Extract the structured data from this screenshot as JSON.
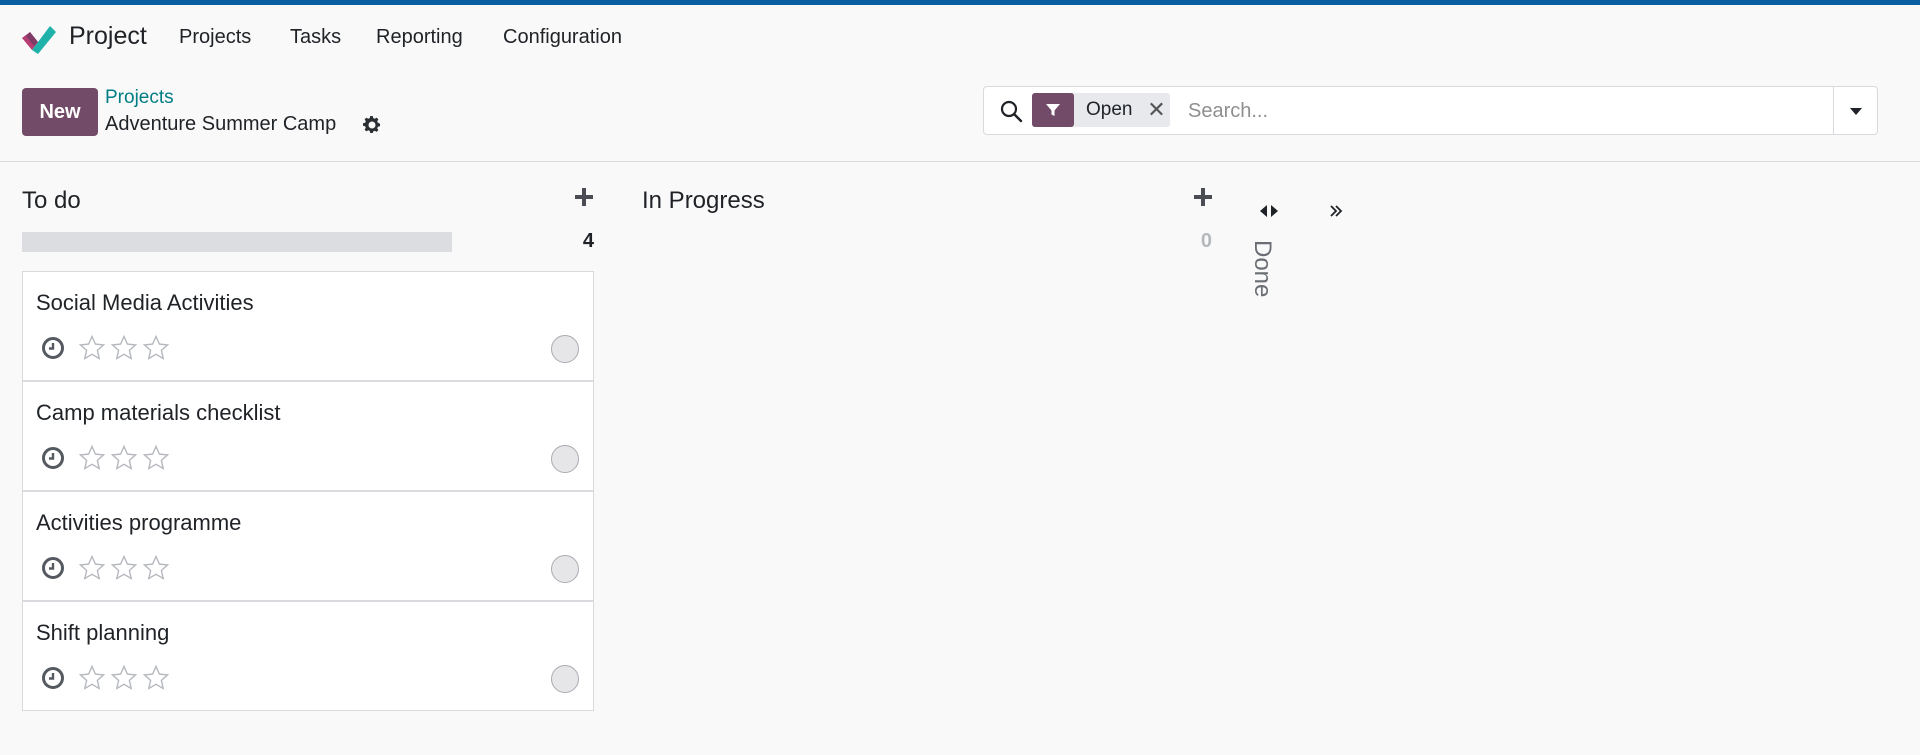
{
  "navbar": {
    "app_name": "Project",
    "menu": [
      "Projects",
      "Tasks",
      "Reporting",
      "Configuration"
    ]
  },
  "control_panel": {
    "new_label": "New",
    "breadcrumb_parent": "Projects",
    "breadcrumb_current": "Adventure Summer Camp",
    "search": {
      "facet_label": "Open",
      "placeholder": "Search..."
    }
  },
  "columns": [
    {
      "title": "To do",
      "count": "4",
      "cards": [
        {
          "title": "Social Media Activities"
        },
        {
          "title": "Camp materials checklist"
        },
        {
          "title": "Activities programme"
        },
        {
          "title": "Shift planning"
        }
      ]
    },
    {
      "title": "In Progress",
      "count": "0",
      "cards": []
    },
    {
      "title": "Done",
      "folded": true
    }
  ],
  "colors": {
    "brand": "#714b67",
    "topbar": "#0b5fa0",
    "link": "#017e84"
  },
  "icons": [
    "project-logo-icon",
    "gear-icon",
    "search-icon",
    "filter-icon",
    "close-icon",
    "caret-down-icon",
    "plus-icon",
    "clock-icon",
    "star-icon",
    "status-circle-icon",
    "fold-arrows-icon",
    "double-chevron-right-icon"
  ]
}
